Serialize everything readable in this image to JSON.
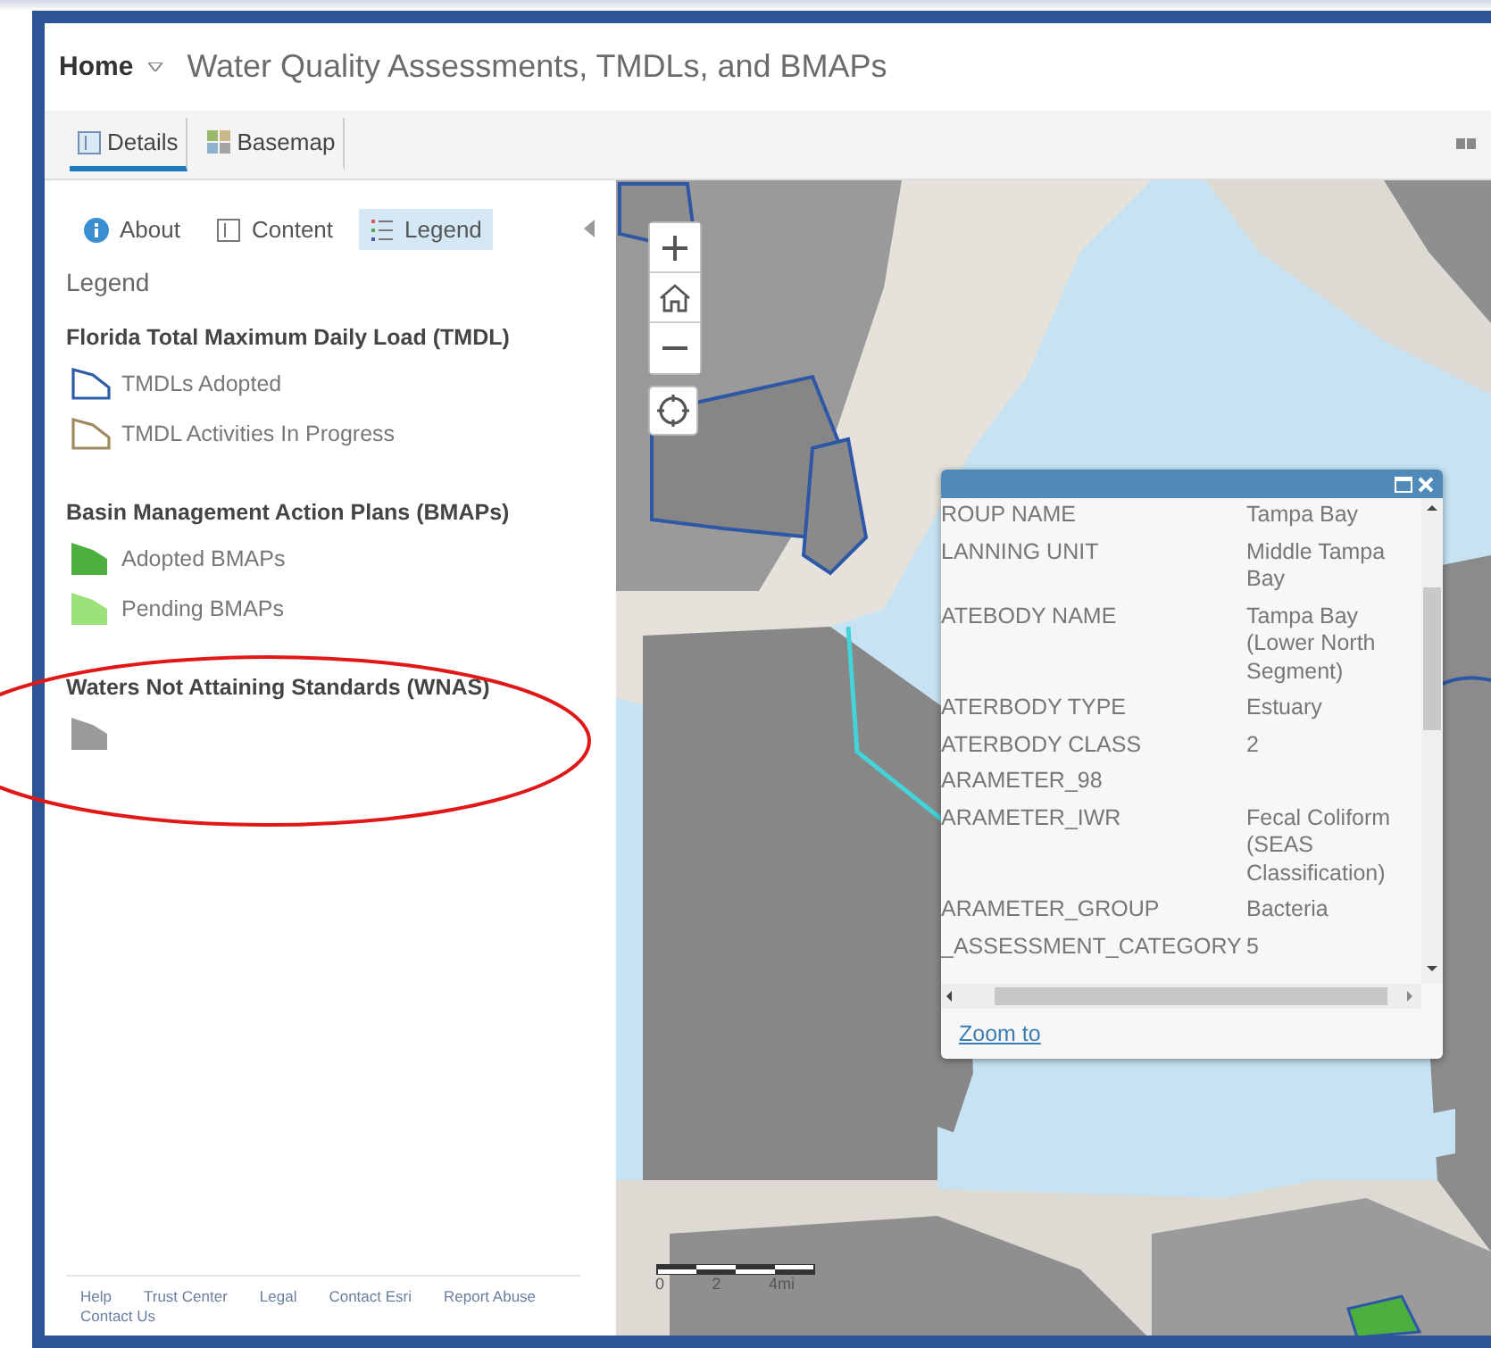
{
  "header": {
    "home": "Home",
    "title": "Water Quality Assessments, TMDLs, and BMAPs"
  },
  "toolbar": {
    "tabs": [
      {
        "label": "Details",
        "selected": true
      },
      {
        "label": "Basemap",
        "selected": false
      }
    ]
  },
  "panel": {
    "tabs": [
      {
        "label": "About",
        "selected": false
      },
      {
        "label": "Content",
        "selected": false
      },
      {
        "label": "Legend",
        "selected": true
      }
    ],
    "heading": "Legend",
    "groups": [
      {
        "title": "Florida Total Maximum Daily Load (TMDL)",
        "items": [
          {
            "kind": "outline",
            "color": "#2f5ea8",
            "label": "TMDLs Adopted"
          },
          {
            "kind": "outline",
            "color": "#a08a60",
            "label": "TMDL Activities In Progress"
          }
        ]
      },
      {
        "title": "Basin Management Action Plans (BMAPs)",
        "items": [
          {
            "kind": "fill",
            "color": "#4caf3e",
            "label": "Adopted BMAPs"
          },
          {
            "kind": "fill",
            "color": "#9be27a",
            "label": "Pending BMAPs"
          }
        ]
      },
      {
        "title": "Waters Not Attaining Standards (WNAS)",
        "items": [
          {
            "kind": "fill",
            "color": "#9a9a9a"
          }
        ]
      }
    ],
    "footer": [
      "Help",
      "Trust Center",
      "Legal",
      "Contact Esri",
      "Report Abuse",
      "Contact Us"
    ]
  },
  "map": {
    "scale": [
      "0",
      "2",
      "4mi"
    ],
    "popup": {
      "rows": [
        {
          "field": "ROUP NAME",
          "value": "Tampa Bay"
        },
        {
          "field": "LANNING UNIT",
          "value": "Middle Tampa Bay"
        },
        {
          "field": "ATEBODY NAME",
          "value": "Tampa Bay (Lower North Segment)"
        },
        {
          "field": "ATERBODY TYPE",
          "value": "Estuary"
        },
        {
          "field": "ATERBODY CLASS",
          "value": "2"
        },
        {
          "field": "ARAMETER_98"
        },
        {
          "field": "ARAMETER_IWR",
          "value": "Fecal Coliform (SEAS Classification)"
        },
        {
          "field": "ARAMETER_GROUP",
          "value": "Bacteria"
        },
        {
          "field": "_ASSESSMENT_CATEGORY",
          "value": "5"
        }
      ],
      "link": "Zoom to"
    }
  }
}
